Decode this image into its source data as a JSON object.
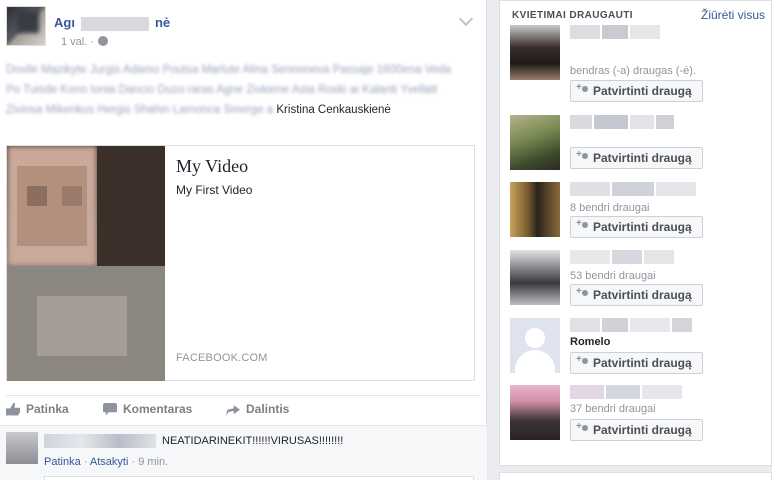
{
  "post": {
    "author_first": "Agı",
    "author_last": "nė",
    "timestamp": "1 val. ·",
    "tagged_visible_end": "Kristina Cenkauskienė",
    "tagged_blurred": "Dovile Mazikyte Jurgis Adamo Poutsa Marlute Alina Sennoneva Passaje 1600ena Veda Po Tuisde Kono Ionia Dancio Duzo raras Agne Zivkiene Asta Roski ai Kalanti Yvellatt Zivinsa Mikenkus Hergis Shahin Lamonca Smerge a"
  },
  "share_card": {
    "title": "My Video",
    "description": "My First Video",
    "domain": "FACEBOOK.COM"
  },
  "actions": {
    "like": "Patinka",
    "comment": "Komentaras",
    "share": "Dalintis"
  },
  "comment": {
    "text": "NEATIDARINEKIT!!!!!!VIRUSAS!!!!!!!!",
    "like": "Patinka",
    "reply": "Atsakyti",
    "time": "9 min."
  },
  "sidebar": {
    "title": "KVIETIMAI DRAUGAUTI",
    "see_all": "Žiūrėti visus",
    "confirm_label": "Patvirtinti draugą",
    "requests": [
      {
        "mutual": "bendras (-a) draugas (-ė)."
      },
      {
        "mutual": ""
      },
      {
        "mutual": "8 bendri draugai"
      },
      {
        "mutual": "53 bendri draugai"
      },
      {
        "mutual": "Romelo"
      },
      {
        "mutual": "37 bendri draugai"
      }
    ]
  }
}
